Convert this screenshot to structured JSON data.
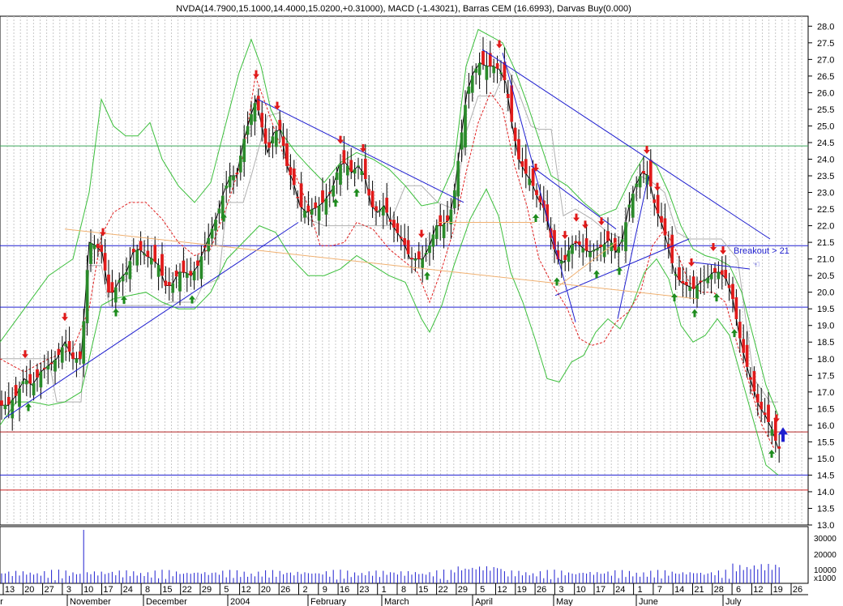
{
  "chart_data": {
    "type": "candlestick",
    "title": "NVDA(14.7900,15.1000,14.4000,15.0200,+0.31000), MACD (-1.43021), Barras CEM (16.6993), Darvas Buy(0.000)",
    "ylim": [
      13.0,
      28.3
    ],
    "y_ticks": [
      "13.0",
      "13.5",
      "14.0",
      "14.5",
      "15.0",
      "15.5",
      "16.0",
      "16.5",
      "17.0",
      "17.5",
      "18.0",
      "18.5",
      "19.0",
      "19.5",
      "20.0",
      "20.5",
      "21.0",
      "21.5",
      "22.0",
      "22.5",
      "23.0",
      "23.5",
      "24.0",
      "24.5",
      "25.0",
      "25.5",
      "26.0",
      "26.5",
      "27.0",
      "27.5",
      "28.0"
    ],
    "volume_ticks": [
      "30000",
      "20000",
      "10000",
      "x1000"
    ],
    "x_day_labels": [
      "13",
      "20",
      "27",
      "3",
      "10",
      "17",
      "24",
      "8",
      "15",
      "22",
      "29",
      "5",
      "12",
      "20",
      "26",
      "2",
      "9",
      "16",
      "23",
      "1",
      "8",
      "15",
      "22",
      "29",
      "5",
      "12",
      "19",
      "26",
      "3",
      "10",
      "17",
      "24",
      "1",
      "7",
      "14",
      "21",
      "28",
      "6",
      "12",
      "19",
      "26"
    ],
    "x_month_labels": [
      "er",
      "November",
      "December",
      "2004",
      "February",
      "March",
      "April",
      "May",
      "June",
      "July"
    ],
    "horizontal_levels": [
      {
        "y": 24.4,
        "color": "#3aa85a"
      },
      {
        "y": 21.4,
        "color": "#1f1fd0"
      },
      {
        "y": 19.55,
        "color": "#1f1fd0"
      },
      {
        "y": 15.8,
        "color": "#b22222"
      },
      {
        "y": 14.5,
        "color": "#1f1fd0"
      },
      {
        "y": 14.05,
        "color": "#cc2222"
      }
    ],
    "close_path": [
      [
        0,
        16.6
      ],
      [
        10,
        16.6
      ],
      [
        20,
        16.9
      ],
      [
        30,
        17.4
      ],
      [
        40,
        17.2
      ],
      [
        50,
        17.6
      ],
      [
        60,
        17.8
      ],
      [
        70,
        18.0
      ],
      [
        80,
        18.5
      ],
      [
        90,
        18.0
      ],
      [
        100,
        18.0
      ],
      [
        110,
        21.5
      ],
      [
        118,
        21.4
      ],
      [
        126,
        21.2
      ],
      [
        134,
        20.0
      ],
      [
        140,
        20.0
      ],
      [
        148,
        20.4
      ],
      [
        156,
        20.6
      ],
      [
        164,
        21.2
      ],
      [
        172,
        21.3
      ],
      [
        180,
        21.1
      ],
      [
        188,
        21.0
      ],
      [
        196,
        20.8
      ],
      [
        204,
        20.2
      ],
      [
        212,
        20.2
      ],
      [
        220,
        20.6
      ],
      [
        228,
        20.6
      ],
      [
        236,
        20.5
      ],
      [
        244,
        20.8
      ],
      [
        252,
        21.3
      ],
      [
        260,
        21.8
      ],
      [
        268,
        22.3
      ],
      [
        276,
        23.0
      ],
      [
        284,
        23.5
      ],
      [
        292,
        23.5
      ],
      [
        300,
        24.5
      ],
      [
        308,
        25.2
      ],
      [
        316,
        25.8
      ],
      [
        322,
        25.1
      ],
      [
        330,
        24.2
      ],
      [
        338,
        24.8
      ],
      [
        346,
        24.9
      ],
      [
        354,
        23.8
      ],
      [
        362,
        23.3
      ],
      [
        370,
        22.6
      ],
      [
        378,
        22.4
      ],
      [
        386,
        22.5
      ],
      [
        394,
        22.6
      ],
      [
        402,
        22.8
      ],
      [
        410,
        23.1
      ],
      [
        418,
        23.8
      ],
      [
        426,
        23.9
      ],
      [
        434,
        23.6
      ],
      [
        442,
        23.8
      ],
      [
        450,
        23.5
      ],
      [
        458,
        22.6
      ],
      [
        466,
        22.4
      ],
      [
        474,
        22.6
      ],
      [
        482,
        22.1
      ],
      [
        490,
        21.8
      ],
      [
        498,
        21.5
      ],
      [
        506,
        21.0
      ],
      [
        514,
        21.0
      ],
      [
        522,
        21.0
      ],
      [
        530,
        21.4
      ],
      [
        538,
        22.0
      ],
      [
        546,
        22.0
      ],
      [
        554,
        22.2
      ],
      [
        560,
        22.9
      ],
      [
        568,
        24.5
      ],
      [
        576,
        26.0
      ],
      [
        584,
        26.6
      ],
      [
        592,
        26.9
      ],
      [
        600,
        26.8
      ],
      [
        608,
        26.8
      ],
      [
        616,
        26.7
      ],
      [
        624,
        26.3
      ],
      [
        632,
        25.0
      ],
      [
        640,
        24.0
      ],
      [
        648,
        23.6
      ],
      [
        656,
        23.3
      ],
      [
        664,
        22.8
      ],
      [
        672,
        22.5
      ],
      [
        680,
        21.6
      ],
      [
        688,
        21.0
      ],
      [
        696,
        20.9
      ],
      [
        704,
        21.4
      ],
      [
        712,
        21.5
      ],
      [
        720,
        21.3
      ],
      [
        728,
        21.2
      ],
      [
        736,
        21.3
      ],
      [
        744,
        21.4
      ],
      [
        752,
        21.6
      ],
      [
        760,
        21.2
      ],
      [
        768,
        21.6
      ],
      [
        776,
        22.6
      ],
      [
        784,
        23.2
      ],
      [
        792,
        23.6
      ],
      [
        800,
        23.5
      ],
      [
        808,
        22.6
      ],
      [
        816,
        22.1
      ],
      [
        824,
        21.4
      ],
      [
        832,
        20.6
      ],
      [
        840,
        20.3
      ],
      [
        848,
        20.2
      ],
      [
        856,
        20.1
      ],
      [
        864,
        20.3
      ],
      [
        872,
        20.4
      ],
      [
        880,
        20.6
      ],
      [
        888,
        20.6
      ],
      [
        896,
        20.4
      ],
      [
        904,
        19.8
      ],
      [
        912,
        18.7
      ],
      [
        920,
        17.9
      ],
      [
        928,
        17.2
      ],
      [
        936,
        16.6
      ],
      [
        944,
        16.3
      ],
      [
        952,
        15.9
      ],
      [
        960,
        15.3
      ]
    ],
    "upper_band": [
      [
        0,
        18.5
      ],
      [
        30,
        19.5
      ],
      [
        60,
        20.5
      ],
      [
        90,
        21.0
      ],
      [
        110,
        23.0
      ],
      [
        125,
        25.8
      ],
      [
        140,
        25.0
      ],
      [
        155,
        24.7
      ],
      [
        170,
        24.7
      ],
      [
        185,
        25.1
      ],
      [
        200,
        24.0
      ],
      [
        220,
        23.2
      ],
      [
        240,
        22.7
      ],
      [
        260,
        23.3
      ],
      [
        280,
        25.2
      ],
      [
        295,
        26.6
      ],
      [
        310,
        27.6
      ],
      [
        322,
        26.8
      ],
      [
        334,
        25.5
      ],
      [
        350,
        24.7
      ],
      [
        365,
        24.2
      ],
      [
        380,
        23.8
      ],
      [
        400,
        23.3
      ],
      [
        420,
        23.9
      ],
      [
        440,
        24.2
      ],
      [
        460,
        24.0
      ],
      [
        480,
        23.7
      ],
      [
        500,
        23.2
      ],
      [
        520,
        22.6
      ],
      [
        540,
        22.7
      ],
      [
        560,
        23.8
      ],
      [
        575,
        26.8
      ],
      [
        590,
        27.9
      ],
      [
        605,
        27.7
      ],
      [
        620,
        27.5
      ],
      [
        635,
        26.7
      ],
      [
        650,
        25.7
      ],
      [
        665,
        24.6
      ],
      [
        680,
        23.5
      ],
      [
        700,
        23.2
      ],
      [
        720,
        22.7
      ],
      [
        740,
        22.3
      ],
      [
        760,
        22.5
      ],
      [
        780,
        23.5
      ],
      [
        795,
        24.1
      ],
      [
        810,
        23.8
      ],
      [
        825,
        23.0
      ],
      [
        840,
        22.0
      ],
      [
        855,
        21.3
      ],
      [
        870,
        21.1
      ],
      [
        885,
        21.0
      ],
      [
        900,
        20.8
      ],
      [
        915,
        20.0
      ],
      [
        930,
        18.6
      ],
      [
        945,
        17.2
      ],
      [
        960,
        16.3
      ]
    ],
    "lower_band": [
      [
        0,
        16.0
      ],
      [
        20,
        16.7
      ],
      [
        40,
        16.7
      ],
      [
        60,
        16.6
      ],
      [
        80,
        16.7
      ],
      [
        100,
        17.0
      ],
      [
        110,
        18.0
      ],
      [
        125,
        19.6
      ],
      [
        140,
        19.8
      ],
      [
        160,
        19.9
      ],
      [
        180,
        20.0
      ],
      [
        200,
        19.7
      ],
      [
        220,
        19.5
      ],
      [
        240,
        19.5
      ],
      [
        260,
        20.0
      ],
      [
        280,
        21.0
      ],
      [
        300,
        21.5
      ],
      [
        320,
        22.0
      ],
      [
        340,
        21.8
      ],
      [
        360,
        21.0
      ],
      [
        380,
        20.5
      ],
      [
        400,
        20.5
      ],
      [
        420,
        20.7
      ],
      [
        440,
        21.1
      ],
      [
        460,
        20.8
      ],
      [
        480,
        20.5
      ],
      [
        500,
        20.3
      ],
      [
        520,
        19.2
      ],
      [
        530,
        18.8
      ],
      [
        545,
        19.6
      ],
      [
        560,
        20.8
      ],
      [
        580,
        22.2
      ],
      [
        600,
        23.1
      ],
      [
        615,
        22.3
      ],
      [
        630,
        20.6
      ],
      [
        645,
        19.7
      ],
      [
        660,
        18.6
      ],
      [
        675,
        17.4
      ],
      [
        690,
        17.3
      ],
      [
        705,
        17.9
      ],
      [
        720,
        18.1
      ],
      [
        735,
        18.8
      ],
      [
        750,
        19.2
      ],
      [
        765,
        18.9
      ],
      [
        780,
        19.6
      ],
      [
        795,
        20.6
      ],
      [
        810,
        21.0
      ],
      [
        825,
        20.4
      ],
      [
        840,
        19.0
      ],
      [
        855,
        18.5
      ],
      [
        870,
        18.7
      ],
      [
        885,
        19.2
      ],
      [
        900,
        18.7
      ],
      [
        915,
        17.4
      ],
      [
        930,
        16.1
      ],
      [
        945,
        14.8
      ],
      [
        960,
        14.5
      ]
    ],
    "moving_avg": [
      [
        0,
        18.0
      ],
      [
        30,
        17.6
      ],
      [
        60,
        18.0
      ],
      [
        90,
        18.3
      ],
      [
        110,
        19.5
      ],
      [
        125,
        21.7
      ],
      [
        140,
        22.4
      ],
      [
        160,
        22.7
      ],
      [
        180,
        22.7
      ],
      [
        200,
        22.2
      ],
      [
        220,
        21.5
      ],
      [
        240,
        21.1
      ],
      [
        260,
        21.3
      ],
      [
        280,
        22.6
      ],
      [
        300,
        24.1
      ],
      [
        315,
        26.5
      ],
      [
        330,
        25.5
      ],
      [
        350,
        24.1
      ],
      [
        365,
        23.5
      ],
      [
        380,
        22.6
      ],
      [
        395,
        21.4
      ],
      [
        410,
        21.4
      ],
      [
        425,
        21.5
      ],
      [
        440,
        22.1
      ],
      [
        460,
        21.9
      ],
      [
        480,
        21.3
      ],
      [
        500,
        20.9
      ],
      [
        515,
        20.6
      ],
      [
        530,
        19.7
      ],
      [
        545,
        20.7
      ],
      [
        560,
        21.9
      ],
      [
        575,
        23.6
      ],
      [
        590,
        25.1
      ],
      [
        605,
        26.0
      ],
      [
        620,
        25.5
      ],
      [
        635,
        23.8
      ],
      [
        650,
        22.6
      ],
      [
        665,
        21.0
      ],
      [
        680,
        20.3
      ],
      [
        700,
        19.5
      ],
      [
        715,
        18.6
      ],
      [
        730,
        18.4
      ],
      [
        745,
        18.5
      ],
      [
        760,
        19.1
      ],
      [
        775,
        19.4
      ],
      [
        790,
        20.0
      ],
      [
        805,
        21.4
      ],
      [
        820,
        21.9
      ],
      [
        835,
        21.2
      ],
      [
        850,
        20.3
      ],
      [
        865,
        20.0
      ],
      [
        880,
        20.0
      ],
      [
        895,
        19.7
      ],
      [
        910,
        18.4
      ],
      [
        925,
        17.2
      ],
      [
        940,
        16.0
      ],
      [
        955,
        15.3
      ]
    ],
    "darvas_line": [
      [
        0,
        18.0
      ],
      [
        60,
        18.0
      ],
      [
        70,
        16.7
      ],
      [
        100,
        16.7
      ],
      [
        110,
        20.8
      ],
      [
        125,
        20.8
      ],
      [
        135,
        19.6
      ],
      [
        160,
        19.6
      ],
      [
        165,
        19.6
      ],
      [
        200,
        19.6
      ],
      [
        210,
        19.7
      ],
      [
        240,
        19.7
      ],
      [
        250,
        20.2
      ],
      [
        270,
        20.4
      ],
      [
        280,
        22.7
      ],
      [
        300,
        22.7
      ],
      [
        310,
        23.5
      ],
      [
        330,
        25.3
      ],
      [
        345,
        25.4
      ],
      [
        360,
        23.2
      ],
      [
        380,
        22.2
      ],
      [
        400,
        22.0
      ],
      [
        420,
        22.0
      ],
      [
        440,
        22.0
      ],
      [
        460,
        22.0
      ],
      [
        480,
        22.0
      ],
      [
        500,
        23.2
      ],
      [
        520,
        23.2
      ],
      [
        540,
        22.7
      ],
      [
        560,
        22.5
      ],
      [
        575,
        24.8
      ],
      [
        590,
        25.9
      ],
      [
        610,
        25.9
      ],
      [
        625,
        26.8
      ],
      [
        640,
        26.0
      ],
      [
        655,
        25.0
      ],
      [
        665,
        24.9
      ],
      [
        680,
        24.9
      ],
      [
        695,
        22.3
      ],
      [
        710,
        22.5
      ],
      [
        730,
        22.2
      ],
      [
        750,
        21.8
      ],
      [
        770,
        21.6
      ],
      [
        790,
        23.5
      ],
      [
        805,
        23.3
      ],
      [
        820,
        23.0
      ],
      [
        835,
        21.8
      ],
      [
        850,
        21.6
      ],
      [
        870,
        21.6
      ],
      [
        890,
        21.6
      ],
      [
        910,
        21.0
      ],
      [
        930,
        17.4
      ],
      [
        950,
        16.7
      ],
      [
        960,
        16.7
      ]
    ],
    "up_arrows": [
      35,
      143,
      153,
      237,
      276,
      414,
      440,
      527,
      661,
      687,
      736,
      764,
      832,
      857,
      884,
      906,
      952
    ],
    "down_arrows": [
      31,
      80,
      127,
      316,
      342,
      420,
      448,
      520,
      616,
      661,
      697,
      711,
      722,
      742,
      798,
      811,
      853,
      880,
      892,
      958
    ],
    "trendlines": [
      {
        "x1": 5,
        "y1": 16.2,
        "x2": 368,
        "y2": 22.1,
        "color": "#1f1fd0"
      },
      {
        "x1": 318,
        "y1": 25.8,
        "x2": 572,
        "y2": 22.7,
        "color": "#1f1fd0"
      },
      {
        "x1": 595,
        "y1": 27.3,
        "x2": 950,
        "y2": 21.6,
        "color": "#1f1fd0"
      },
      {
        "x1": 620,
        "y1": 27.2,
        "x2": 710,
        "y2": 19.1,
        "color": "#1f1fd0"
      },
      {
        "x1": 655,
        "y1": 23.8,
        "x2": 760,
        "y2": 21.9,
        "color": "#1f1fd0"
      },
      {
        "x1": 685,
        "y1": 19.9,
        "x2": 850,
        "y2": 21.6,
        "color": "#1f1fd0"
      },
      {
        "x1": 762,
        "y1": 19.2,
        "x2": 800,
        "y2": 23.5,
        "color": "#1f1fd0"
      },
      {
        "x1": 855,
        "y1": 20.9,
        "x2": 925,
        "y2": 20.7,
        "color": "#1f1fd0"
      },
      {
        "x1": 80,
        "y1": 21.9,
        "x2": 860,
        "y2": 19.8,
        "color": "#f0b070"
      },
      {
        "x1": 540,
        "y1": 22.1,
        "x2": 660,
        "y2": 22.1,
        "color": "#f0b070"
      },
      {
        "x1": 690,
        "y1": 20.2,
        "x2": 760,
        "y2": 21.5,
        "color": "#f0b070"
      }
    ],
    "breakout_label": "Breakout > 21",
    "volume_spike_x": 104
  }
}
